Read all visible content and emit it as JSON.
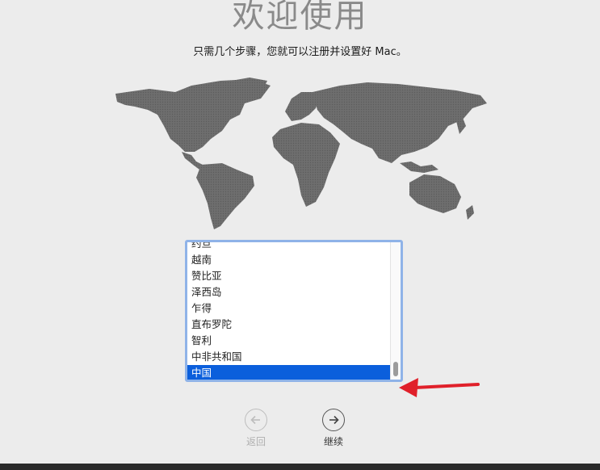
{
  "header": {
    "title": "欢迎使用",
    "subtitle": "只需几个步骤，您就可以注册并设置好 Mac。"
  },
  "country_list": {
    "items": [
      {
        "label": "约旦"
      },
      {
        "label": "越南"
      },
      {
        "label": "赞比亚"
      },
      {
        "label": "泽西岛"
      },
      {
        "label": "乍得"
      },
      {
        "label": "直布罗陀"
      },
      {
        "label": "智利"
      },
      {
        "label": "中非共和国"
      },
      {
        "label": "中国",
        "selected": true
      }
    ],
    "selected": "中国"
  },
  "navigation": {
    "back_label": "返回",
    "continue_label": "继续"
  },
  "colors": {
    "selection": "#0b5fdc",
    "annotation_arrow": "#e0202a",
    "map_land": "#6b6b6b"
  }
}
